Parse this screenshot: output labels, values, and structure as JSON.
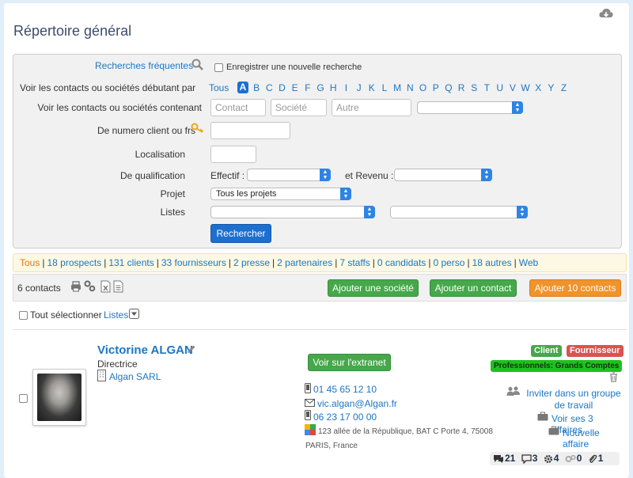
{
  "page": {
    "title": "Répertoire général"
  },
  "search": {
    "frequent_label": "Recherches fréquentes",
    "save_search_label": "Enregistrer une nouvelle recherche",
    "starting_with_label": "Voir les contacts ou sociétés débutant par",
    "letters": [
      "Tous",
      "A",
      "B",
      "C",
      "D",
      "E",
      "F",
      "G",
      "H",
      "I",
      "J",
      "K",
      "L",
      "M",
      "N",
      "O",
      "P",
      "Q",
      "R",
      "S",
      "T",
      "U",
      "V",
      "W",
      "X",
      "Y",
      "Z"
    ],
    "active_letter": "A",
    "containing_label": "Voir les contacts ou sociétés contenant",
    "contact_placeholder": "Contact",
    "company_placeholder": "Société",
    "other_placeholder": "Autre",
    "client_number_label": "De numero client ou frs",
    "location_label": "Localisation",
    "qualification_label": "De qualification",
    "staff_label": "Effectif :",
    "revenue_label": "et Revenu :",
    "project_label": "Projet",
    "project_value": "Tous les projets",
    "lists_label": "Listes",
    "search_button": "Rechercher"
  },
  "filters": [
    "Tous",
    "18 prospects",
    "131 clients",
    "33 fournisseurs",
    "2 presse",
    "2 partenaires",
    "7 staffs",
    "0 candidats",
    "0 perso",
    "18 autres",
    "Web"
  ],
  "toolbar": {
    "count": "6 contacts",
    "add_company": "Ajouter une société",
    "add_contact": "Ajouter un contact",
    "add_10_contacts": "Ajouter 10 contacts",
    "select_all": "Tout sélectionner",
    "lists_link": "Listes"
  },
  "contact": {
    "name": "Victorine ALGAN",
    "role": "Directrice",
    "company": "Algan SARL",
    "extranet_button": "Voir sur l'extranet",
    "phone": "01 45 65 12 10",
    "email": "vic.algan@Algan.fr",
    "mobile": "06 23 17 00 00",
    "address": "123 allée de la République, BAT C Porte 4, 75008",
    "city": "PARIS, France",
    "badges": {
      "client": "Client",
      "supplier": "Fournisseur",
      "segment": "Professionnels: Grands Comptes"
    },
    "invite_group": "Inviter dans un groupe de travail",
    "see_deals": "Voir ses 3 affaires",
    "new_deal": "Nouvelle affaire",
    "stats": {
      "comments": "21",
      "messages": "3",
      "tasks": "4",
      "auto": "0",
      "attachments": "1"
    }
  },
  "colors": {
    "link": "#1b76c5",
    "primary_button": "#1d6fcf",
    "green_button": "#45a84a",
    "orange_button": "#f0932a",
    "badge_client": "#45a84a",
    "badge_supplier": "#d9534f",
    "badge_segment": "#1ec11e",
    "background": "#dfeef8"
  }
}
